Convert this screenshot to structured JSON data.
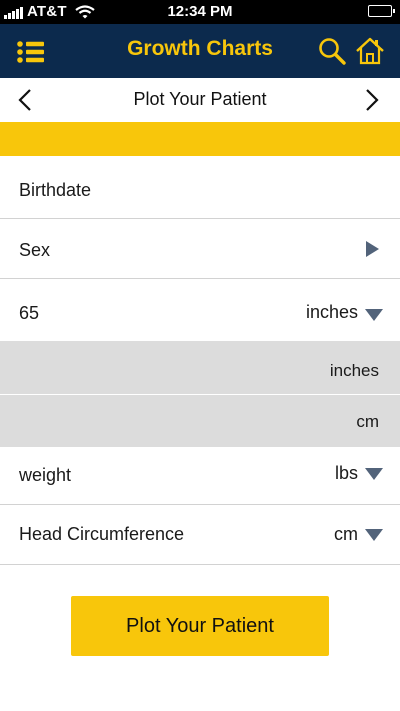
{
  "status_bar": {
    "carrier": "AT&T",
    "time": "12:34 PM"
  },
  "app_bar": {
    "title": "Growth Charts",
    "menu_icon": "list-menu-icon",
    "search_icon": "search-icon",
    "home_icon": "home-icon",
    "background_color": "#0c2a4d",
    "accent_color": "#f8c60b"
  },
  "nav": {
    "title": "Plot Your Patient",
    "prev_icon": "chevron-left-icon",
    "next_icon": "chevron-right-icon"
  },
  "form": {
    "birthdate": {
      "label": "Birthdate"
    },
    "sex": {
      "label": "Sex",
      "icon": "triangle-right-icon"
    },
    "height": {
      "value": "65",
      "unit": "inches",
      "icon": "triangle-down-icon"
    },
    "height_unit_options": [
      "inches",
      "cm"
    ],
    "weight": {
      "label": "weight",
      "unit": "lbs",
      "icon": "triangle-down-icon"
    },
    "head_circumference": {
      "label": "Head Circumference",
      "unit": "cm",
      "icon": "triangle-down-icon"
    }
  },
  "plot_button": {
    "label": "Plot Your Patient"
  }
}
